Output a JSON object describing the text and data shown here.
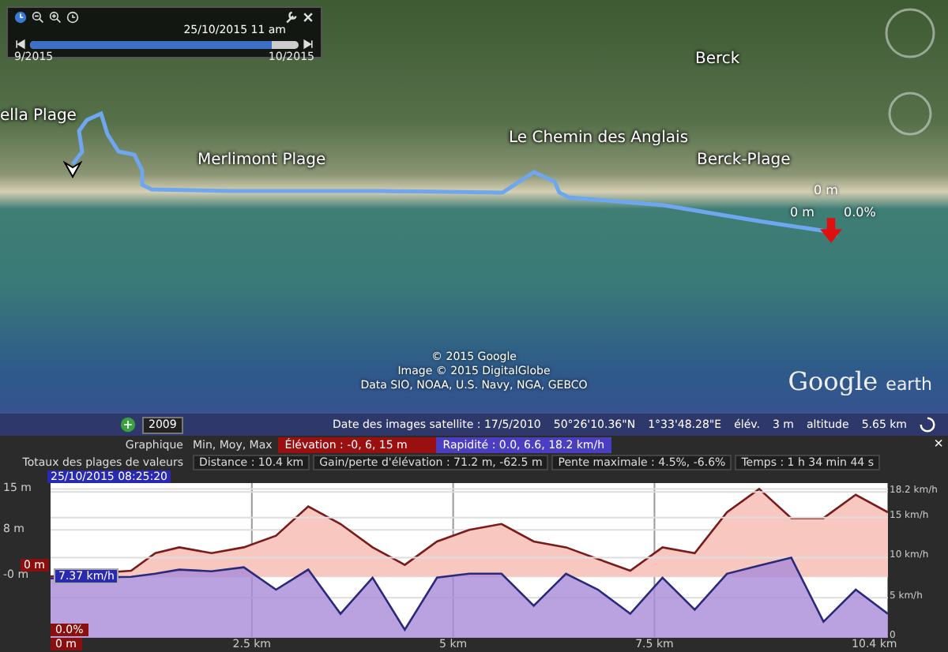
{
  "time_slider": {
    "current": "25/10/2015  11 am",
    "start": "9/2015",
    "end": "10/2015",
    "level": 0.9
  },
  "map": {
    "labels": [
      {
        "text": "Berck",
        "kind": "place"
      },
      {
        "text": "ella Plage",
        "kind": "place"
      },
      {
        "text": "Le Chemin des Anglais",
        "kind": "place"
      },
      {
        "text": "Merlimont Plage",
        "kind": "place"
      },
      {
        "text": "Berck-Plage",
        "kind": "place"
      },
      {
        "text": "0 m",
        "kind": "readout"
      },
      {
        "text": "0 m",
        "kind": "readout"
      },
      {
        "text": "0.0%",
        "kind": "readout"
      }
    ],
    "credits": [
      "© 2015 Google",
      "Image © 2015 DigitalGlobe",
      "Data SIO, NOAA, U.S. Navy, NGA, GEBCO"
    ],
    "logo": {
      "brand": "Google",
      "product": "earth"
    }
  },
  "status_bar": {
    "year_button": "2009",
    "imagery_date": "Date des images satellite : 17/5/2010",
    "latitude": "50°26'10.36\"N",
    "longitude": "1°33'48.28\"E",
    "elevation_label": "élév.",
    "elevation": "3 m",
    "altitude_label": "altitude",
    "altitude": "5.65 km"
  },
  "profile": {
    "graph_label": "Graphique",
    "stats_label": "Min, Moy, Max",
    "series_stats": [
      {
        "text": "Élévation : -0, 6, 15 m",
        "color": "#9a1010"
      },
      {
        "text": "Rapidité : 0.0, 6.6, 18.2 km/h",
        "color": "#4a3fc0"
      }
    ],
    "close": "×",
    "totals_label": "Totaux des plages de valeurs",
    "totals": [
      "Distance : 10.4 km",
      "Gain/perte d'élévation : 71.2 m, -62.5 m",
      "Pente maximale : 4.5%, -6.6%",
      "Temps : 1 h 34 min 44 s"
    ],
    "cursor_time": "25/10/2015 08:25:20",
    "cursor_elevation": "0 m",
    "cursor_speed": "7.37 km/h",
    "cursor_slope": "0.0%",
    "cursor_distance": "0 m",
    "elevation_chart": {
      "chart_data": {
        "type": "area",
        "x": [
          0,
          1.0,
          1.3,
          1.6,
          2.0,
          2.4,
          2.8,
          3.2,
          3.6,
          4.0,
          4.4,
          4.8,
          5.2,
          5.6,
          6.0,
          6.4,
          6.8,
          7.2,
          7.6,
          8.0,
          8.4,
          8.8,
          9.2,
          9.6,
          10.0,
          10.4
        ],
        "series": [
          {
            "color": "#7a1a1a",
            "values": [
              0,
              1,
              4,
              5,
              4,
              5,
              7,
              12,
              9,
              5,
              2,
              6,
              8,
              9,
              6,
              5,
              3,
              1,
              5,
              4,
              11,
              15,
              10,
              10,
              14,
              11
            ]
          }
        ],
        "xlim": [
          0,
          10.4
        ],
        "ylim": [
          -10.5,
          16
        ],
        "xticks": [
          {
            "value": 2.5,
            "label": "2.5 km"
          },
          {
            "value": 5,
            "label": "5 km"
          },
          {
            "value": 7.5,
            "label": "7.5 km"
          },
          {
            "value": 10.4,
            "label": "10.4 km"
          }
        ],
        "yticks": [
          {
            "value": 15,
            "label": "15 m"
          },
          {
            "value": 8,
            "label": "8 m"
          },
          {
            "value": 0,
            "label": "-0 m"
          }
        ],
        "grid": true
      }
    },
    "speed_chart": {
      "chart_data": {
        "type": "area",
        "x": [
          0,
          1.0,
          1.3,
          1.6,
          2.0,
          2.4,
          2.8,
          3.2,
          3.6,
          4.0,
          4.4,
          4.8,
          5.2,
          5.6,
          6.0,
          6.4,
          6.8,
          7.2,
          7.6,
          8.0,
          8.4,
          8.8,
          9.2,
          9.6,
          10.0,
          10.4
        ],
        "series": [
          {
            "color": "#2a2a7a",
            "values": [
              7.4,
              7.6,
              8,
              8.5,
              8.3,
              8.8,
              6,
              8.5,
              3,
              7.5,
              1,
              7.5,
              8,
              8,
              4,
              8,
              6,
              3,
              7.5,
              3.5,
              8,
              9,
              10,
              2,
              6,
              3
            ]
          }
        ],
        "xlim": [
          0,
          10.4
        ],
        "ylim": [
          0,
          19.3
        ],
        "yticks": [
          {
            "value": 18.2,
            "label": "18.2 km/h"
          },
          {
            "value": 15,
            "label": "15 km/h"
          },
          {
            "value": 10,
            "label": "10 km/h"
          },
          {
            "value": 5,
            "label": "5 km/h"
          },
          {
            "value": 0,
            "label": "0"
          }
        ],
        "grid": true
      }
    }
  }
}
